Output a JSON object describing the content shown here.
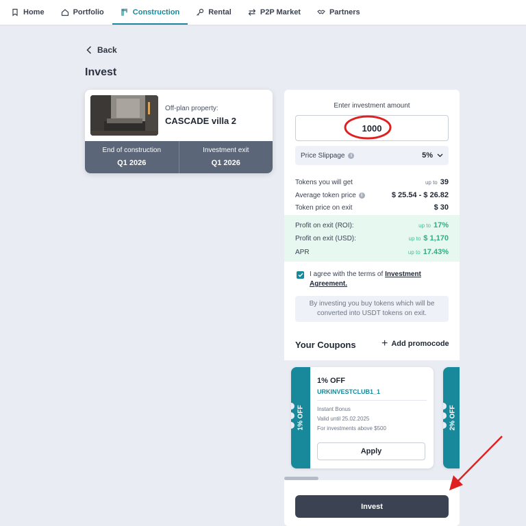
{
  "nav": {
    "items": [
      {
        "label": "Home",
        "icon": "bookmark-icon",
        "active": false
      },
      {
        "label": "Portfolio",
        "icon": "house-icon",
        "active": false
      },
      {
        "label": "Construction",
        "icon": "crane-icon",
        "active": true
      },
      {
        "label": "Rental",
        "icon": "key-icon",
        "active": false
      },
      {
        "label": "P2P Market",
        "icon": "swap-arrows-icon",
        "active": false
      },
      {
        "label": "Partners",
        "icon": "handshake-icon",
        "active": false
      }
    ]
  },
  "page": {
    "back_label": "Back",
    "title": "Invest"
  },
  "property": {
    "subtitle": "Off-plan property:",
    "name": "CASCADE villa 2",
    "construction_label": "End of construction",
    "construction_value": "Q1 2026",
    "exit_label": "Investment exit",
    "exit_value": "Q1 2026"
  },
  "invest": {
    "amount_label": "Enter investment amount",
    "amount_value": "1000",
    "slippage_label": "Price Slippage",
    "slippage_value": "5%",
    "tokens_label": "Tokens you will get",
    "tokens_prefix": "up to",
    "tokens_value": "39",
    "avg_price_label": "Average token price",
    "avg_price_value": "$ 25.54 - $ 26.82",
    "exit_price_label": "Token price on exit",
    "exit_price_value": "$ 30",
    "roi_label": "Profit on exit (ROI):",
    "roi_prefix": "up to",
    "roi_value": "17%",
    "usd_label": "Profit on exit (USD):",
    "usd_prefix": "up to",
    "usd_value": "$ 1,170",
    "apr_label": "APR",
    "apr_prefix": "up to",
    "apr_value": "17.43%",
    "agree_text": "I agree with the terms of",
    "agree_link": "Investment Agreement.",
    "agree_checked": true,
    "note": "By investing you buy tokens which will be converted into USDT tokens on exit.",
    "invest_button": "Invest"
  },
  "coupons": {
    "heading": "Your Coupons",
    "add_label": "Add promocode",
    "items": [
      {
        "side_label": "1% OFF",
        "title": "1% OFF",
        "code": "URKINVESTCLUB1_1",
        "line1": "Instant Bonus",
        "line2": "Valid until 25.02.2025",
        "line3": "For investments above $500",
        "apply": "Apply"
      },
      {
        "side_label": "2% OFF"
      }
    ]
  },
  "colors": {
    "accent": "#17899a",
    "annotation": "#e02020"
  }
}
